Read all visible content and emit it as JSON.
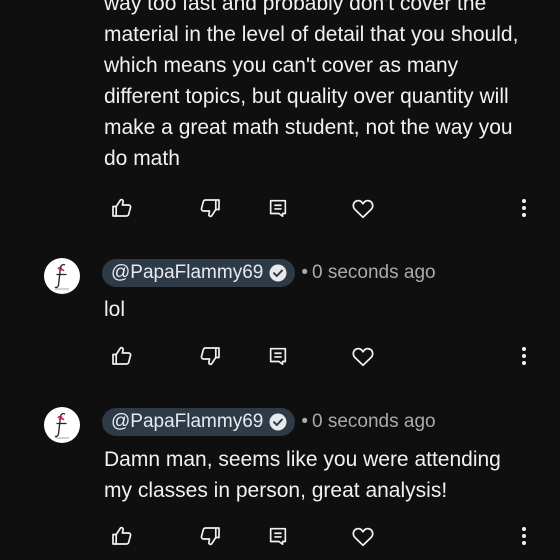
{
  "comments": [
    {
      "text": "way too fast and probably don't cover the\nmaterial in the level of detail that you should,\nwhich means you can't cover as many\ndifferent topics, but quality over quantity will\nmake a great math student, not the way you\ndo math"
    },
    {
      "handle": "@PapaFlammy69",
      "separator": "•",
      "time": "0 seconds ago",
      "text": "lol"
    },
    {
      "handle": "@PapaFlammy69",
      "separator": "•",
      "time": "0 seconds ago",
      "text": "Damn man, seems like you were attending\nmy classes in person, great analysis!"
    }
  ],
  "icons": {
    "like": "thumb-up-icon",
    "dislike": "thumb-down-icon",
    "reply": "reply-comment-icon",
    "heart": "heart-icon",
    "more": "more-vertical-icon",
    "verified": "verified-check-icon"
  },
  "colors": {
    "background": "#0f0f0f",
    "text": "#f1f1f1",
    "meta": "#aaaaaa",
    "handle_pill": "#2f3a47"
  }
}
